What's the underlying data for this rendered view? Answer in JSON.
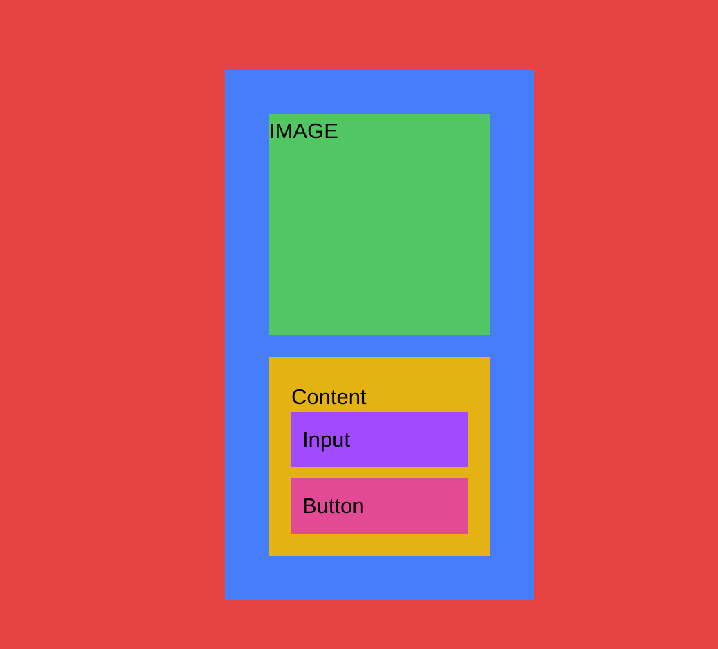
{
  "colors": {
    "background": "#e64444",
    "card": "#457dfb",
    "image": "#50c763",
    "content": "#e5b213",
    "input": "#a24bfc",
    "button": "#e34a95"
  },
  "image": {
    "label": "IMAGE"
  },
  "content": {
    "label": "Content",
    "input_label": "Input",
    "button_label": "Button"
  }
}
